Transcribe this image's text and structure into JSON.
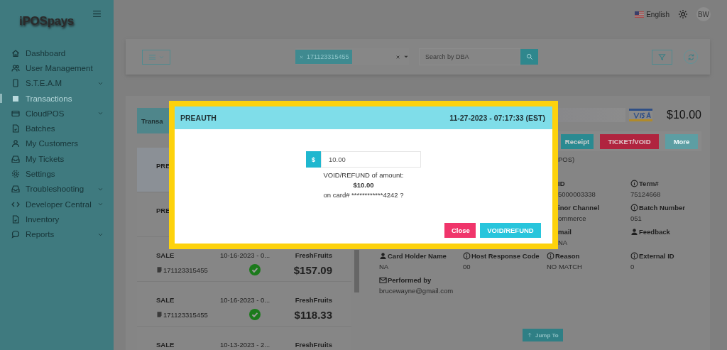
{
  "sidebar": {
    "logo": "iPOSpays",
    "items": [
      {
        "label": "Dashboard",
        "expandable": false,
        "selected": false
      },
      {
        "label": "User Management",
        "expandable": false,
        "selected": false
      },
      {
        "label": "S.T.E.A.M",
        "expandable": true,
        "selected": false
      },
      {
        "label": "Transactions",
        "expandable": false,
        "selected": true
      },
      {
        "label": "CloudPOS",
        "expandable": true,
        "selected": false
      },
      {
        "label": "Batches",
        "expandable": false,
        "selected": false
      },
      {
        "label": "My Customers",
        "expandable": false,
        "selected": false
      },
      {
        "label": "My Tickets",
        "expandable": false,
        "selected": false
      },
      {
        "label": "Settings",
        "expandable": false,
        "selected": false
      },
      {
        "label": "Troubleshooting",
        "expandable": true,
        "selected": false
      },
      {
        "label": "Developer Central",
        "expandable": true,
        "selected": false
      },
      {
        "label": "Inventory",
        "expandable": false,
        "selected": false
      },
      {
        "label": "Reports",
        "expandable": true,
        "selected": false
      }
    ]
  },
  "header": {
    "language": "English",
    "avatar": "BW"
  },
  "filters": {
    "chip": "171123315455",
    "search_placeholder": "Search by DBA"
  },
  "list": {
    "tab": "Transa",
    "rows": [
      {
        "type": "PRE",
        "selected": true
      },
      {
        "type": "PRE",
        "selected": false
      },
      {
        "type": "SALE",
        "date": "10-16-2023 - 0...",
        "merchant": "FreshFruits",
        "id": "171123315455",
        "amount": "$157.09",
        "selected": false
      },
      {
        "type": "SALE",
        "date": "10-16-2023 - 0...",
        "merchant": "FreshFruits",
        "id": "171123315455",
        "amount": "$118.33",
        "selected": false
      },
      {
        "type": "SALE",
        "date": "10-13-2023 - 2...",
        "merchant": "FreshFruits",
        "selected": false
      }
    ]
  },
  "detail": {
    "amount": "$10.00",
    "buttons": [
      {
        "label": "Receipt",
        "kind": "primary"
      },
      {
        "label": "TICKET/VOID",
        "kind": "danger"
      },
      {
        "label": "More",
        "kind": "muted"
      }
    ],
    "rows": [
      [
        null,
        null,
        {
          "value": "POS)",
          "kind": "partial"
        },
        null
      ],
      [
        null,
        null,
        {
          "label": "ID",
          "value": "5000003338",
          "kind": "partial"
        },
        {
          "label": "Term#",
          "value": "75124668"
        }
      ],
      [
        null,
        null,
        {
          "label": "inor Channel",
          "value": "ommerce",
          "kind": "partial"
        },
        {
          "label": "Batch Number",
          "value": "051"
        }
      ],
      [
        null,
        null,
        {
          "label": "mail",
          "value": "NA",
          "kind": "partial"
        },
        {
          "label": "Feedback"
        }
      ],
      [
        {
          "label": "Card Holder Name",
          "value": "NA"
        },
        {
          "label": "Host Response Code",
          "value": "00"
        },
        {
          "label": "Reason",
          "value": "NO MATCH"
        },
        {
          "label": "External ID",
          "value": "0"
        }
      ],
      [
        {
          "label": "Performed by",
          "value": "brucewayne@gmail.com"
        },
        null,
        null,
        null
      ]
    ],
    "jump": "Jump To"
  },
  "modal": {
    "title": "PREAUTH",
    "datetime": "11-27-2023 - 07:17:33 (EST)",
    "currency": "$",
    "amount_value": "10.00",
    "message": "VOID/REFUND of amount:",
    "amount": "$10.00",
    "card": "on card# ************4242 ?",
    "buttons": [
      {
        "label": "Close",
        "kind": "danger"
      },
      {
        "label": "VOID/REFUND",
        "kind": "primary"
      }
    ]
  }
}
